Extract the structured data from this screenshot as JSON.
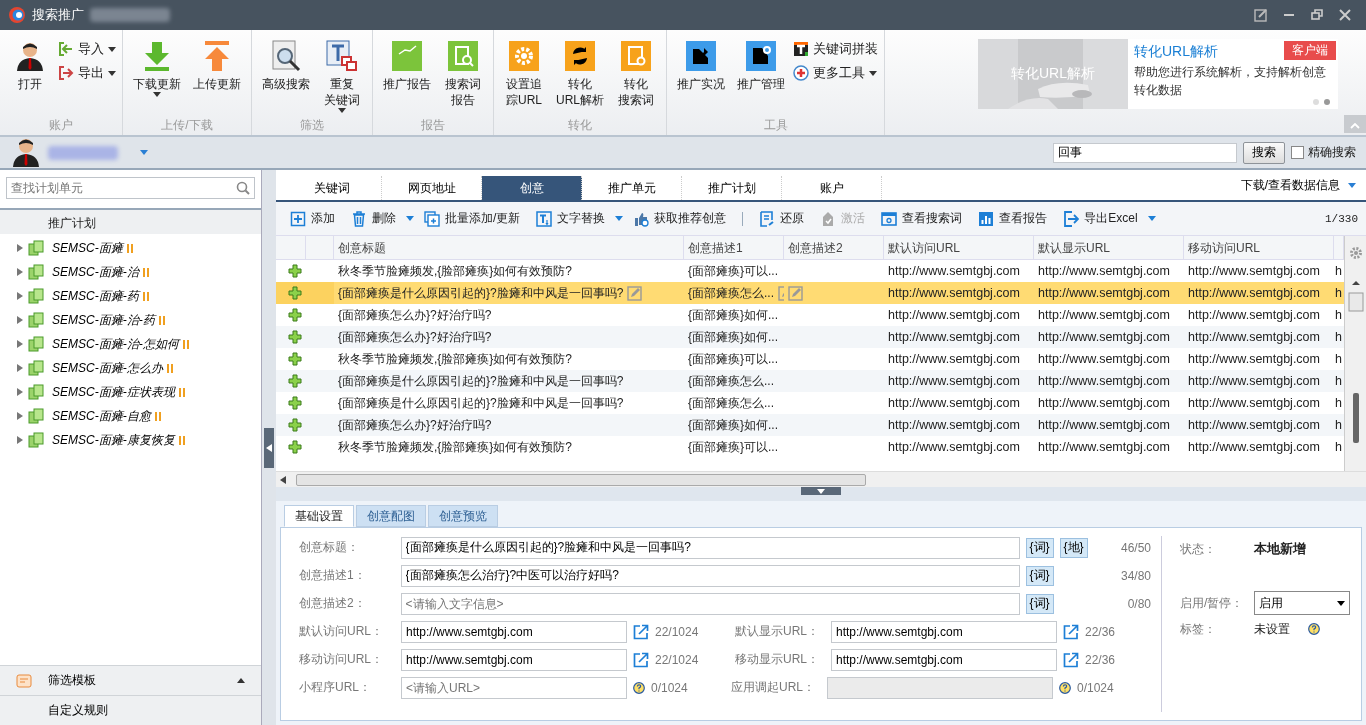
{
  "window": {
    "title": "搜索推广"
  },
  "ribbon": {
    "groups": [
      {
        "label": "账户",
        "buttons": [
          {
            "kind": "large",
            "label": "打开",
            "dropdown": false
          },
          {
            "kind": "small",
            "label": "导入",
            "dropdown": true
          },
          {
            "kind": "small",
            "label": "导出",
            "dropdown": true
          }
        ]
      },
      {
        "label": "上传/下载",
        "buttons": [
          {
            "kind": "large",
            "label": "下载更新",
            "dropdown": true
          },
          {
            "kind": "large",
            "label": "上传更新",
            "dropdown": false
          }
        ]
      },
      {
        "label": "筛选",
        "buttons": [
          {
            "kind": "large",
            "label": "高级搜索",
            "dropdown": false
          },
          {
            "kind": "large",
            "lines": [
              "重复",
              "关键词"
            ],
            "dropdown": true
          }
        ]
      },
      {
        "label": "报告",
        "buttons": [
          {
            "kind": "large",
            "label": "推广报告",
            "dropdown": false
          },
          {
            "kind": "large",
            "lines": [
              "搜索词",
              "报告"
            ],
            "dropdown": false
          }
        ]
      },
      {
        "label": "转化",
        "buttons": [
          {
            "kind": "large",
            "lines": [
              "设置追",
              "踪URL"
            ],
            "dropdown": false
          },
          {
            "kind": "large",
            "lines": [
              "转化",
              "URL解析"
            ],
            "dropdown": false
          },
          {
            "kind": "large",
            "lines": [
              "转化",
              "搜索词"
            ],
            "dropdown": false
          }
        ]
      },
      {
        "label": "工具",
        "buttons": [
          {
            "kind": "large",
            "label": "推广实况",
            "dropdown": false
          },
          {
            "kind": "large",
            "label": "推广管理",
            "dropdown": false
          },
          {
            "kind": "small",
            "label": "关键词拼装",
            "dropdown": false
          },
          {
            "kind": "small",
            "label": "更多工具",
            "dropdown": true
          }
        ]
      }
    ]
  },
  "promo": {
    "image_caption": "转化URL解析",
    "title": "转化URL解析",
    "badge": "客户端",
    "text": "帮助您进行系统解析，支持解析创意转化数据",
    "dots": [
      {
        "selected": false
      },
      {
        "selected": true
      }
    ]
  },
  "account_bar": {
    "search": {
      "value": "回事"
    },
    "search_button": "搜索",
    "exact": {
      "label": "精确搜索",
      "checked": false
    }
  },
  "sidebar": {
    "search": {
      "placeholder": "查找计划单元"
    },
    "header": "推广计划",
    "items": [
      {
        "label": "SEMSC-面瘫",
        "expanded": false
      },
      {
        "label": "SEMSC-面瘫-治",
        "expanded": false
      },
      {
        "label": "SEMSC-面瘫-药",
        "expanded": false
      },
      {
        "label": "SEMSC-面瘫-治-药",
        "expanded": false
      },
      {
        "label": "SEMSC-面瘫-治-怎如何",
        "expanded": false
      },
      {
        "label": "SEMSC-面瘫-怎么办",
        "expanded": false
      },
      {
        "label": "SEMSC-面瘫-症状表现",
        "expanded": false
      },
      {
        "label": "SEMSC-面瘫-自愈",
        "expanded": false
      },
      {
        "label": "SEMSC-面瘫-康复恢复",
        "expanded": false
      }
    ],
    "filter_template": "筛选模板",
    "custom_rules": "自定义规则"
  },
  "tabs": [
    {
      "label": "关键词",
      "selected": false
    },
    {
      "label": "网页地址",
      "selected": false
    },
    {
      "label": "创意",
      "selected": true
    },
    {
      "label": "推广单元",
      "selected": false
    },
    {
      "label": "推广计划",
      "selected": false
    },
    {
      "label": "账户",
      "selected": false
    }
  ],
  "tabs_menu": "下载/查看数据信息",
  "toolbar": {
    "left": [
      {
        "label": "添加",
        "dropdown": false,
        "disabled": false
      },
      {
        "label": "删除",
        "dropdown": true,
        "disabled": false
      },
      {
        "label": "批量添加/更新",
        "dropdown": false,
        "disabled": false
      },
      {
        "label": "文字替换",
        "dropdown": true,
        "disabled": false
      },
      {
        "label": "获取推荐创意",
        "dropdown": false,
        "disabled": false
      }
    ],
    "right": [
      {
        "label": "还原",
        "dropdown": false,
        "disabled": false
      },
      {
        "label": "激活",
        "dropdown": false,
        "disabled": true
      },
      {
        "label": "查看搜索词",
        "dropdown": false,
        "disabled": false
      },
      {
        "label": "查看报告",
        "dropdown": false,
        "disabled": false
      },
      {
        "label": "导出Excel",
        "dropdown": true,
        "disabled": false
      }
    ],
    "pager": "1/330"
  },
  "table": {
    "columns": [
      "创意标题",
      "创意描述1",
      "创意描述2",
      "默认访问URL",
      "默认显示URL",
      "移动访问URL"
    ],
    "rows": [
      {
        "selected": false,
        "title": "秋冬季节脸瘫频发,{脸部瘫痪}如何有效预防?",
        "desc1": "{面部瘫痪}可以...",
        "default_url": "http://www.semtgbj.com",
        "display_url": "http://www.semtgbj.com",
        "mobile_url": "http://www.semtgbj.com",
        "column_9": "h"
      },
      {
        "selected": true,
        "title": "{面部瘫痪是什么原因引起的}?脸瘫和中风是一回事吗?",
        "desc1": "{面部瘫痪怎么...",
        "default_url": "http://www.semtgbj.com",
        "display_url": "http://www.semtgbj.com",
        "mobile_url": "http://www.semtgbj.com",
        "column_9": "h"
      },
      {
        "selected": false,
        "title": "{面部瘫痪怎么办}?好治疗吗?",
        "desc1": "{面部瘫痪}如何...",
        "default_url": "http://www.semtgbj.com",
        "display_url": "http://www.semtgbj.com",
        "mobile_url": "http://www.semtgbj.com",
        "column_9": "h"
      },
      {
        "selected": false,
        "title": "{面部瘫痪怎么办}?好治疗吗?",
        "desc1": "{面部瘫痪}如何...",
        "default_url": "http://www.semtgbj.com",
        "display_url": "http://www.semtgbj.com",
        "mobile_url": "http://www.semtgbj.com",
        "column_9": "h"
      },
      {
        "selected": false,
        "title": "秋冬季节脸瘫频发,{脸部瘫痪}如何有效预防?",
        "desc1": "{面部瘫痪}可以...",
        "default_url": "http://www.semtgbj.com",
        "display_url": "http://www.semtgbj.com",
        "mobile_url": "http://www.semtgbj.com",
        "column_9": "h"
      },
      {
        "selected": false,
        "title": "{面部瘫痪是什么原因引起的}?脸瘫和中风是一回事吗?",
        "desc1": "{面部瘫痪怎么...",
        "default_url": "http://www.semtgbj.com",
        "display_url": "http://www.semtgbj.com",
        "mobile_url": "http://www.semtgbj.com",
        "column_9": "h"
      },
      {
        "selected": false,
        "title": "{面部瘫痪是什么原因引起的}?脸瘫和中风是一回事吗?",
        "desc1": "{面部瘫痪怎么...",
        "default_url": "http://www.semtgbj.com",
        "display_url": "http://www.semtgbj.com",
        "mobile_url": "http://www.semtgbj.com",
        "column_9": "h"
      },
      {
        "selected": false,
        "title": "{面部瘫痪怎么办}?好治疗吗?",
        "desc1": "{面部瘫痪}如何...",
        "default_url": "http://www.semtgbj.com",
        "display_url": "http://www.semtgbj.com",
        "mobile_url": "http://www.semtgbj.com",
        "column_9": "h"
      },
      {
        "selected": false,
        "title": "秋冬季节脸瘫频发,{脸部瘫痪}如何有效预防?",
        "desc1": "{面部瘫痪}可以...",
        "default_url": "http://www.semtgbj.com",
        "display_url": "http://www.semtgbj.com",
        "mobile_url": "http://www.semtgbj.com",
        "column_9": "h"
      }
    ]
  },
  "detail": {
    "tabs": [
      {
        "label": "基础设置",
        "selected": true
      },
      {
        "label": "创意配图",
        "selected": false
      },
      {
        "label": "创意预览",
        "selected": false
      }
    ],
    "text_fields": [
      {
        "label": "创意标题：",
        "value": "{面部瘫痪是什么原因引起的}?脸瘫和中风是一回事吗?",
        "tags": [
          "{词}",
          "{地}"
        ],
        "count": "46/50"
      },
      {
        "label": "创意描述1：",
        "value": "{面部瘫痪怎么治疗}?中医可以治疗好吗?",
        "tags": [
          "{词}"
        ],
        "count": "34/80"
      },
      {
        "label": "创意描述2：",
        "placeholder": "<请输入文字信息>",
        "tags": [
          "{词}"
        ],
        "count": "0/80"
      }
    ],
    "url_rows": [
      {
        "left": {
          "label": "默认访问URL：",
          "value": "http://www.semtgbj.com",
          "kind": "link",
          "count": "22/1024",
          "disabled": false
        },
        "right": {
          "label": "默认显示URL：",
          "value": "http://www.semtgbj.com",
          "kind": "link",
          "count": "22/36",
          "disabled": false
        }
      },
      {
        "left": {
          "label": "移动访问URL：",
          "value": "http://www.semtgbj.com",
          "kind": "link",
          "count": "22/1024",
          "disabled": false
        },
        "right": {
          "label": "移动显示URL：",
          "value": "http://www.semtgbj.com",
          "kind": "link",
          "count": "22/36",
          "disabled": false
        }
      },
      {
        "left": {
          "label": "小程序URL：",
          "placeholder": "<请输入URL>",
          "kind": "help",
          "count": "0/1024",
          "disabled": false
        },
        "right": {
          "label": "应用调起URL：",
          "kind": "help",
          "count": "0/1024",
          "disabled": true
        }
      }
    ],
    "status": {
      "status_label": "状态：",
      "status": "本地新增",
      "toggle_label": "启用/暂停：",
      "toggle_value": "启用",
      "tag_label": "标签：",
      "tag_value": "未设置"
    }
  }
}
